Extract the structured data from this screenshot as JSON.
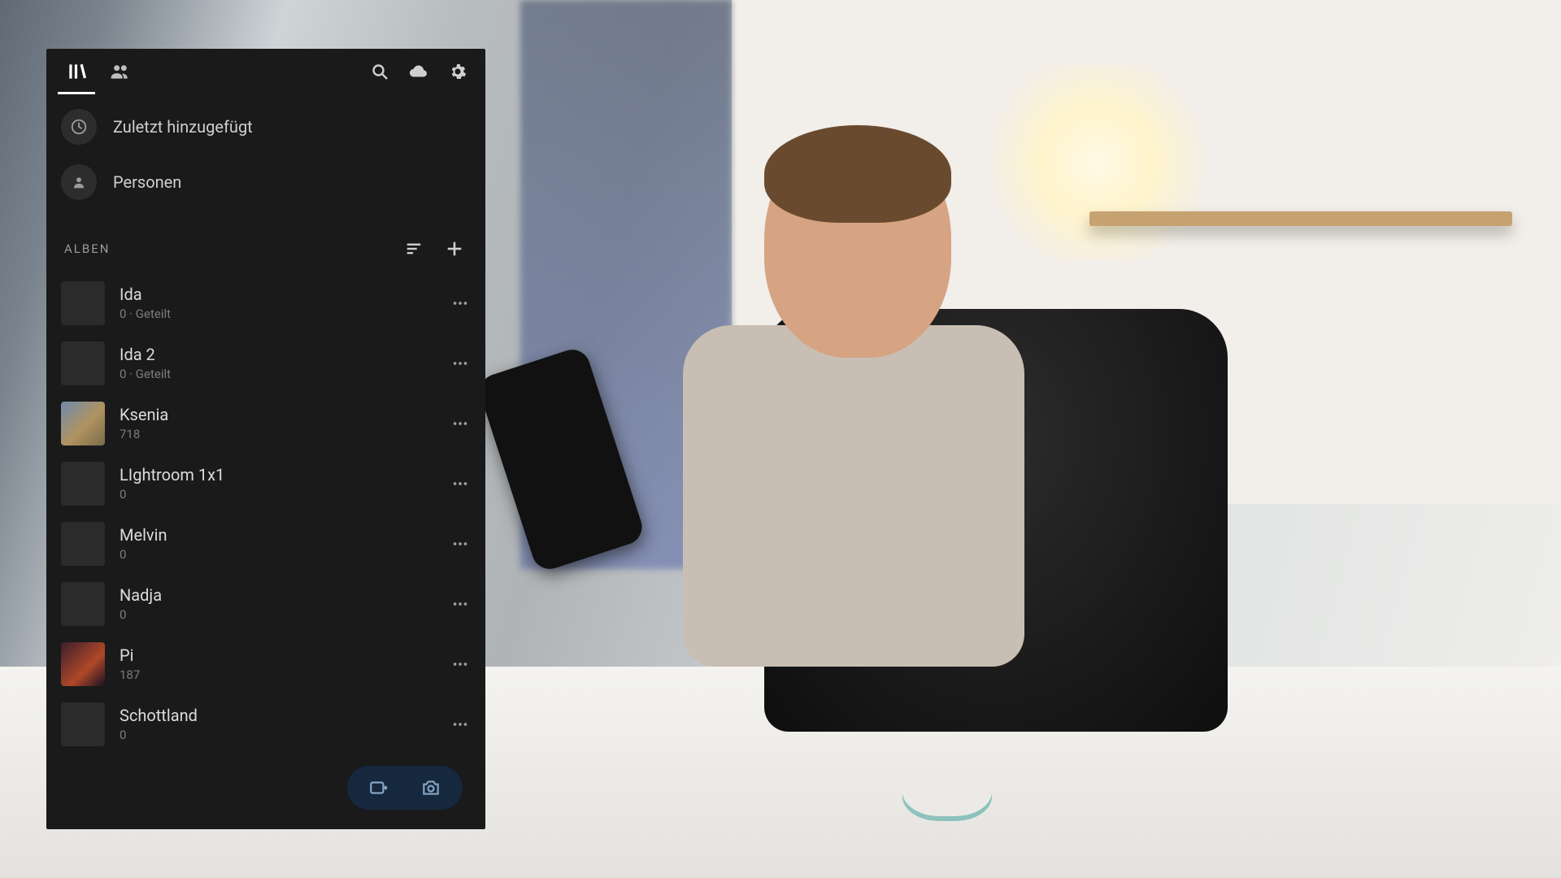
{
  "shortcuts": {
    "recent": {
      "label": "Zuletzt hinzugefügt"
    },
    "people": {
      "label": "Personen"
    }
  },
  "albums_section": {
    "title": "ALBEN"
  },
  "albums": [
    {
      "name": "Ida",
      "meta": "0 · Geteilt",
      "thumb": "empty"
    },
    {
      "name": "Ida 2",
      "meta": "0 · Geteilt",
      "thumb": "empty"
    },
    {
      "name": "Ksenia",
      "meta": "718",
      "thumb": "photo1"
    },
    {
      "name": "LIghtroom 1x1",
      "meta": "0",
      "thumb": "empty"
    },
    {
      "name": "Melvin",
      "meta": "0",
      "thumb": "empty"
    },
    {
      "name": "Nadja",
      "meta": "0",
      "thumb": "empty"
    },
    {
      "name": "Pi",
      "meta": "187",
      "thumb": "photo2"
    },
    {
      "name": "Schottland",
      "meta": "0",
      "thumb": "empty"
    }
  ],
  "thumb_styles": {
    "empty": "#2b2b2b",
    "photo1": "linear-gradient(135deg,#6f8ab0 0%,#b0935f 55%,#7a6a4a 100%)",
    "photo2": "linear-gradient(135deg,#3a1e2d 0%,#b04828 60%,#1a1022 100%)"
  }
}
